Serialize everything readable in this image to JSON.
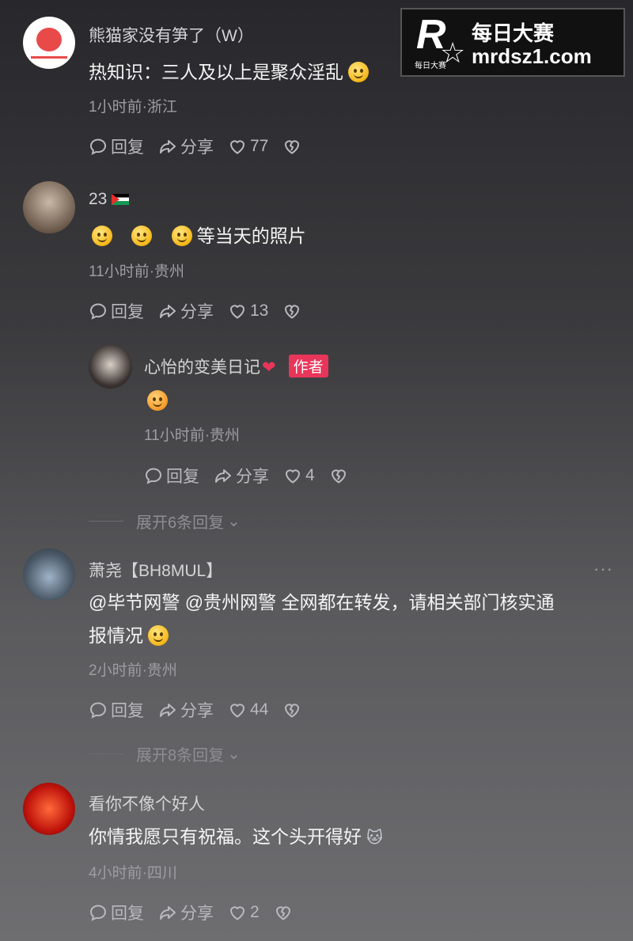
{
  "watermark": {
    "logo_letter": "R",
    "logo_small": "每日大赛",
    "title": "每日大赛",
    "site": "mrdsz1.com"
  },
  "actions_labels": {
    "reply": "回复",
    "share": "分享"
  },
  "comments": [
    {
      "user": "熊猫家没有笋了（W）",
      "text": "热知识：三人及以上是聚众淫乱",
      "meta": "1小时前·浙江",
      "likes": "77"
    },
    {
      "user": "23",
      "text": "等当天的照片",
      "meta": "11小时前·贵州",
      "likes": "13"
    },
    {
      "user": "心怡的变美日记",
      "tag": "作者",
      "meta": "11小时前·贵州",
      "likes": "4"
    },
    {
      "user": "萧尧【BH8MUL】",
      "text_line1": "@毕节网警  @贵州网警  全网都在转发，请相关部门核实通",
      "text_line2": "报情况",
      "meta": "2小时前·贵州",
      "likes": "44"
    },
    {
      "user": "看你不像个好人",
      "text": "你情我愿只有祝福。这个头开得好",
      "meta": "4小时前·四川",
      "likes": "2"
    }
  ],
  "expand_1": "展开6条回复",
  "expand_2": "展开8条回复",
  "colors": {
    "like_accent": "#e8355a",
    "tag_bg": "#e8355a"
  }
}
